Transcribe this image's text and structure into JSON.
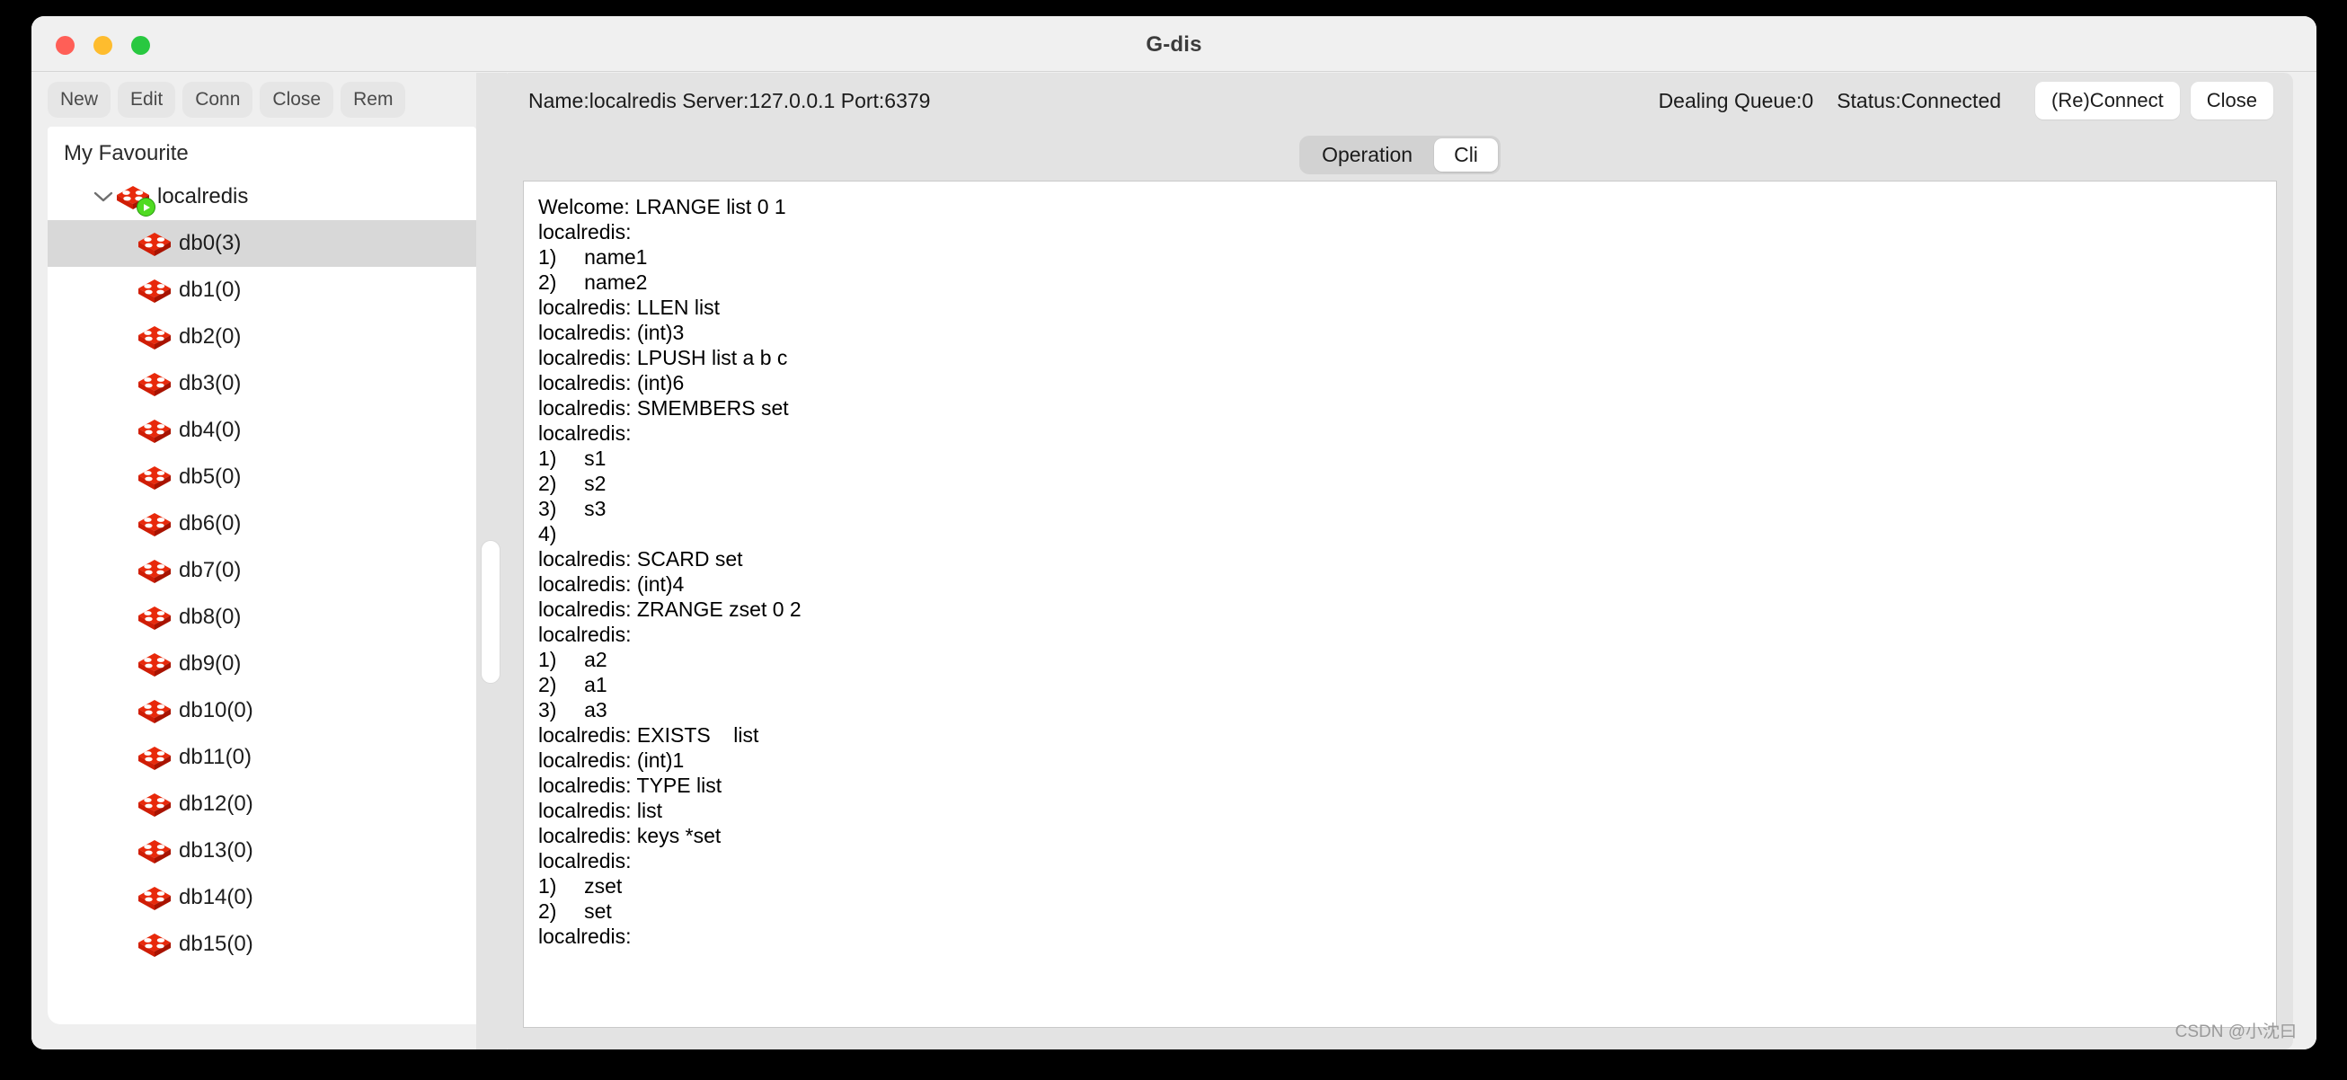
{
  "window": {
    "title": "G-dis",
    "traffic_lights": [
      "close",
      "minimize",
      "maximize"
    ]
  },
  "toolbar": {
    "buttons": [
      {
        "label": "New",
        "name": "new-button"
      },
      {
        "label": "Edit",
        "name": "edit-button"
      },
      {
        "label": "Conn",
        "name": "conn-button"
      },
      {
        "label": "Close",
        "name": "close-button"
      },
      {
        "label": "Rem",
        "name": "rem-button"
      }
    ]
  },
  "sidebar": {
    "header": "My Favourite",
    "connection": {
      "label": "localredis",
      "expanded": true,
      "chevron": "chevron-down-icon",
      "status_badge": "running"
    },
    "databases": [
      {
        "label": "db0(3)",
        "selected": true
      },
      {
        "label": "db1(0)",
        "selected": false
      },
      {
        "label": "db2(0)",
        "selected": false
      },
      {
        "label": "db3(0)",
        "selected": false
      },
      {
        "label": "db4(0)",
        "selected": false
      },
      {
        "label": "db5(0)",
        "selected": false
      },
      {
        "label": "db6(0)",
        "selected": false
      },
      {
        "label": "db7(0)",
        "selected": false
      },
      {
        "label": "db8(0)",
        "selected": false
      },
      {
        "label": "db9(0)",
        "selected": false
      },
      {
        "label": "db10(0)",
        "selected": false
      },
      {
        "label": "db11(0)",
        "selected": false
      },
      {
        "label": "db12(0)",
        "selected": false
      },
      {
        "label": "db13(0)",
        "selected": false
      },
      {
        "label": "db14(0)",
        "selected": false
      },
      {
        "label": "db15(0)",
        "selected": false
      }
    ]
  },
  "connection_bar": {
    "info": "Name:localredis Server:127.0.0.1 Port:6379",
    "queue": "Dealing Queue:0",
    "status": "Status:Connected",
    "reconnect_label": "(Re)Connect",
    "close_label": "Close"
  },
  "tabs": [
    {
      "label": "Operation",
      "active": false
    },
    {
      "label": "Cli",
      "active": true
    }
  ],
  "console": {
    "lines": [
      "Welcome: LRANGE list 0 1",
      "localredis:",
      "1)\tname1",
      "2)\tname2",
      "localredis: LLEN list",
      "localredis: (int)3",
      "localredis: LPUSH list a b c",
      "localredis: (int)6",
      "localredis: SMEMBERS set",
      "localredis:",
      "1)\ts1",
      "2)\ts2",
      "3)\ts3",
      "4)",
      "localredis: SCARD set",
      "localredis: (int)4",
      "localredis: ZRANGE zset 0 2",
      "localredis:",
      "1)\ta2",
      "2)\ta1",
      "3)\ta3",
      "localredis: EXISTS    list",
      "localredis: (int)1",
      "localredis: TYPE list",
      "localredis: list",
      "localredis: keys *set",
      "localredis:",
      "1)\tzset",
      "2)\tset",
      "localredis:"
    ]
  },
  "watermark": "CSDN @小沈曰",
  "colors": {
    "accent_red": "#e8290b",
    "badge_green": "#4fdb22",
    "window_bg": "#f0f0f0",
    "panel_bg": "#e3e3e3",
    "selection": "#d8d8d8"
  }
}
